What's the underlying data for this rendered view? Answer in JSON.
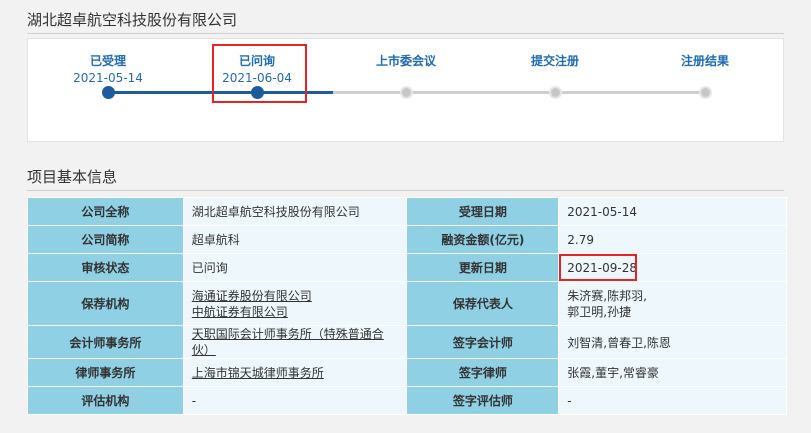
{
  "company_title": "湖北超卓航空科技股份有限公司",
  "progress": {
    "steps": [
      {
        "label": "已受理",
        "date": "2021-05-14",
        "status": "done"
      },
      {
        "label": "已问询",
        "date": "2021-06-04",
        "status": "done"
      },
      {
        "label": "上市委会议",
        "date": "",
        "status": "pending"
      },
      {
        "label": "提交注册",
        "date": "",
        "status": "pending"
      },
      {
        "label": "注册结果",
        "date": "",
        "status": "pending"
      }
    ]
  },
  "section_title": "项目基本信息",
  "info": {
    "rows": [
      {
        "k1": "公司全称",
        "v1": "湖北超卓航空科技股份有限公司",
        "k2": "受理日期",
        "v2": "2021-05-14"
      },
      {
        "k1": "公司简称",
        "v1": "超卓航科",
        "k2": "融资金额(亿元)",
        "v2": "2.79"
      },
      {
        "k1": "审核状态",
        "v1": "已问询",
        "k2": "更新日期",
        "v2": "2021-09-28"
      },
      {
        "k1": "保荐机构",
        "v1a": "海通证券股份有限公司",
        "v1b": "中航证券有限公司",
        "k2": "保荐代表人",
        "v2a": "朱济赛,陈邦羽,",
        "v2b": "郭卫明,孙捷"
      },
      {
        "k1": "会计师事务所",
        "v1": "天职国际会计师事务所（特殊普通合伙）",
        "k2": "签字会计师",
        "v2": "刘智清,曾春卫,陈恩"
      },
      {
        "k1": "律师事务所",
        "v1": "上海市锦天城律师事务所",
        "k2": "签字律师",
        "v2": "张霞,董宇,常睿豪"
      },
      {
        "k1": "评估机构",
        "v1": "-",
        "k2": "签字评估师",
        "v2": "-"
      }
    ]
  },
  "colors": {
    "accent": "#1f6bb5",
    "track_done": "#1d5c9c",
    "key_cell": "#8fd0e4",
    "value_cell": "#eef8fc",
    "highlight": "#e82323"
  }
}
